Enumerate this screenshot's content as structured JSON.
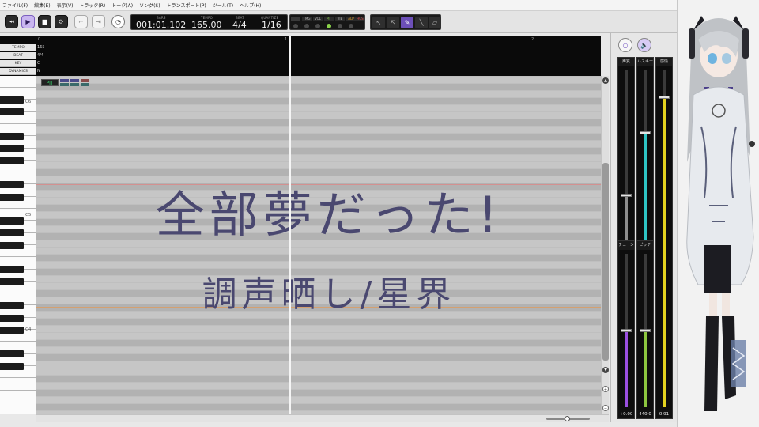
{
  "menu": [
    "ファイル(F)",
    "編集(E)",
    "表示(V)",
    "トラック(R)",
    "トーク(A)",
    "ソング(S)",
    "トランスポート(P)",
    "ツール(T)",
    "ヘルプ(H)"
  ],
  "toolbar": {
    "transport": {
      "bars_label": "BARS",
      "bars_value": "001:01.102",
      "tempo_label": "TEMPO",
      "tempo_value": "165.00",
      "beat_label": "BEAT",
      "beat_value": "4/4",
      "quantize_label": "QUANTIZE",
      "quantize_value": "1/16"
    },
    "track_flags": [
      "TMG",
      "VOL",
      "PIT",
      "VIB",
      "ALP",
      "HUS"
    ]
  },
  "ruler": {
    "lanes": [
      "TEMPO",
      "BEAT",
      "KEY",
      "DYNAMICS"
    ],
    "tempo_value": "165",
    "beat_value": "4/4",
    "key_value": "C",
    "dynamics_value": "N",
    "bar_numbers": [
      "0",
      "1",
      "2"
    ]
  },
  "keyboard": {
    "octave_labels": [
      "C6",
      "C5",
      "C4"
    ]
  },
  "roll": {
    "pit_badge": "PIT",
    "title_main": "全部夢だった!",
    "title_sub": "調声晒し/星界"
  },
  "mixer": {
    "strips": [
      {
        "label": "声質",
        "value": "-0.38",
        "level": 0.3,
        "color": "#8c8c8c"
      },
      {
        "label": "ハスキー",
        "value": "+0.36",
        "level": 0.65,
        "color": "#2ec4c4"
      },
      {
        "label": "感情",
        "value": "0.91",
        "level": 0.92,
        "color": "#e3d21f"
      },
      {
        "label": "チューン",
        "value": "+0.00",
        "level": 0.5,
        "color": "#9a4fe0"
      },
      {
        "label": "ピッチ",
        "value": "440.0",
        "level": 0.5,
        "color": "#8cc63f"
      }
    ]
  },
  "colors": {
    "accent": "#7b5fbf",
    "title_text": "#4a4870"
  }
}
